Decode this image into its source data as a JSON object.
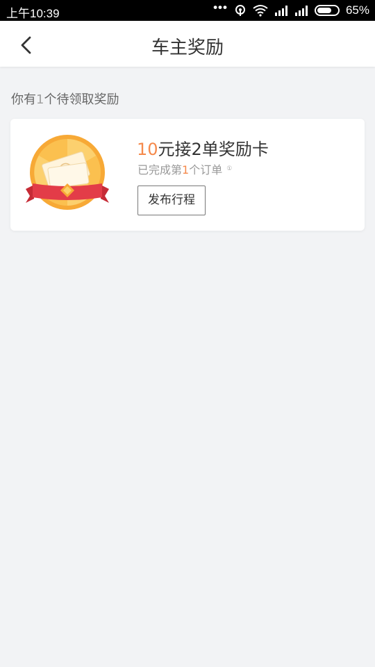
{
  "status_bar": {
    "time": "上午10:39",
    "battery": "65%",
    "dots": "•••"
  },
  "nav": {
    "title": "车主奖励"
  },
  "summary": {
    "prefix": "你有",
    "count": "1",
    "suffix": "个待领取奖励"
  },
  "reward_card": {
    "amount": "10",
    "title_rest": "元接2单奖励卡",
    "progress_prefix": "已完成第",
    "progress_num": "1",
    "progress_suffix": "个订单",
    "info_icon": "①",
    "button_label": "发布行程"
  },
  "colors": {
    "accent": "#f5894b",
    "background": "#f2f3f5"
  }
}
